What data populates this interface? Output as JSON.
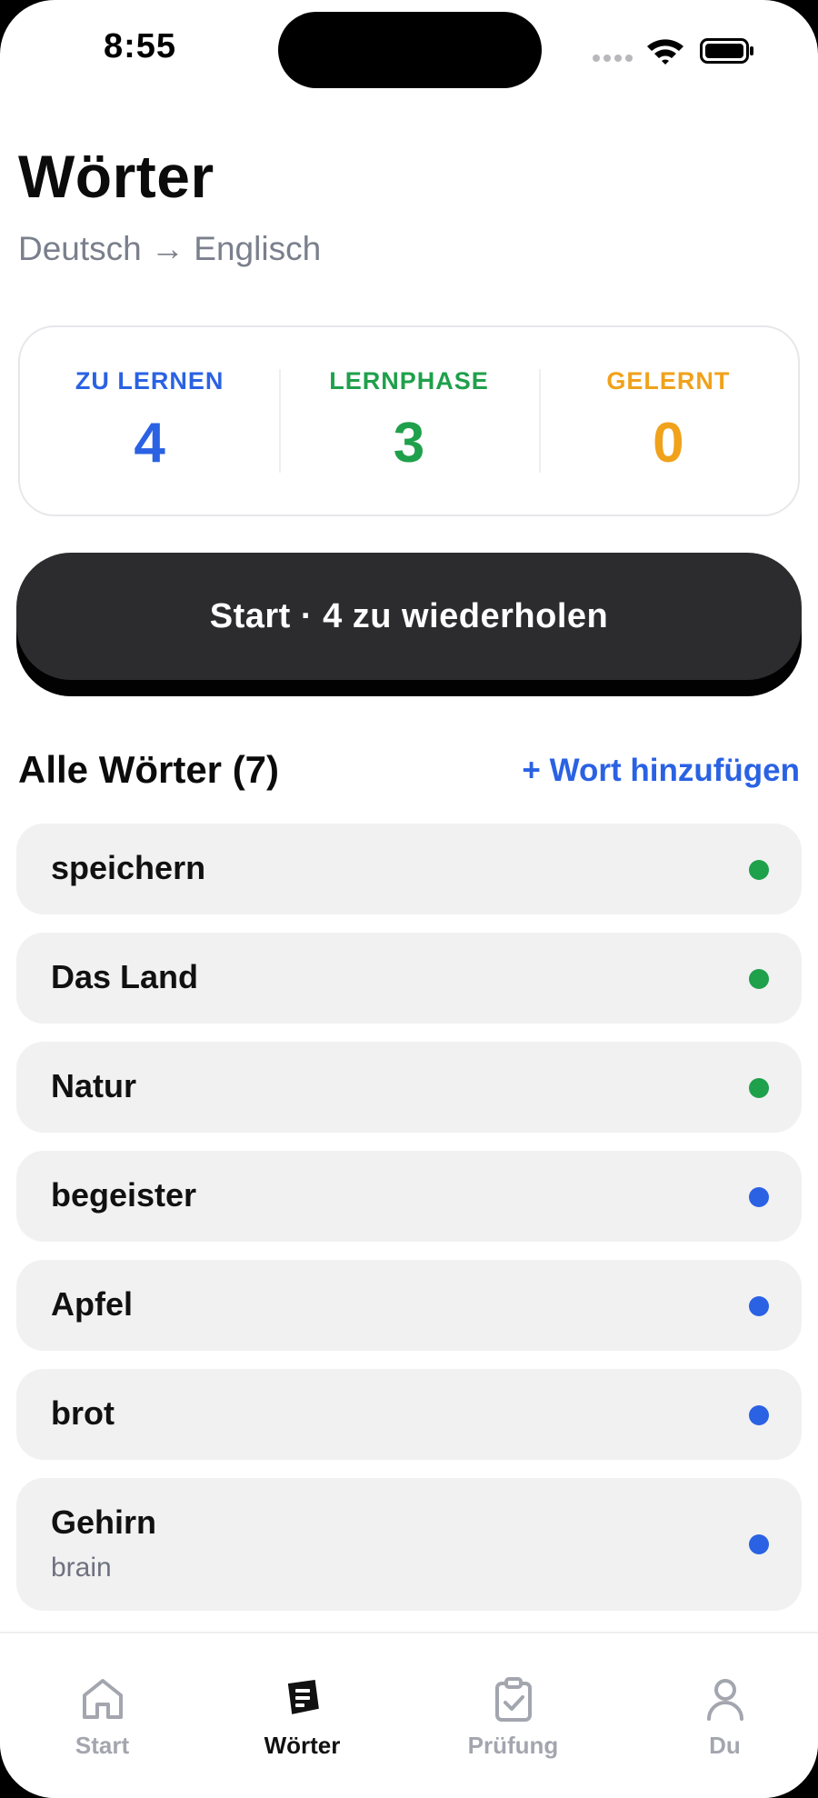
{
  "status_bar": {
    "time": "8:55"
  },
  "header": {
    "title": "Wörter",
    "subtitle": "Deutsch → Englisch"
  },
  "stats": [
    {
      "label": "ZU LERNEN",
      "value": "4",
      "color": "#2a62e3"
    },
    {
      "label": "LERNPHASE",
      "value": "3",
      "color": "#1fa04b"
    },
    {
      "label": "GELERNT",
      "value": "0",
      "color": "#f0a21b"
    }
  ],
  "start_button": {
    "label": "Start · 4 zu wiederholen"
  },
  "section": {
    "title": "Alle Wörter (7)",
    "add_label": "+ Wort hinzufügen"
  },
  "words": [
    {
      "word": "speichern",
      "translation": "",
      "status": "learning",
      "dot_color": "#1fa04b"
    },
    {
      "word": "Das Land",
      "translation": "",
      "status": "learning",
      "dot_color": "#1fa04b"
    },
    {
      "word": "Natur",
      "translation": "",
      "status": "learning",
      "dot_color": "#1fa04b"
    },
    {
      "word": "begeister",
      "translation": "",
      "status": "new",
      "dot_color": "#2a62e3"
    },
    {
      "word": "Apfel",
      "translation": "",
      "status": "new",
      "dot_color": "#2a62e3"
    },
    {
      "word": "brot",
      "translation": "",
      "status": "new",
      "dot_color": "#2a62e3"
    },
    {
      "word": "Gehirn",
      "translation": "brain",
      "status": "new",
      "dot_color": "#2a62e3"
    }
  ],
  "tabs": [
    {
      "label": "Start",
      "icon": "home-icon",
      "active": false
    },
    {
      "label": "Wörter",
      "icon": "notes-icon",
      "active": true
    },
    {
      "label": "Prüfung",
      "icon": "clipboard-check-icon",
      "active": false
    },
    {
      "label": "Du",
      "icon": "user-icon",
      "active": false
    }
  ]
}
